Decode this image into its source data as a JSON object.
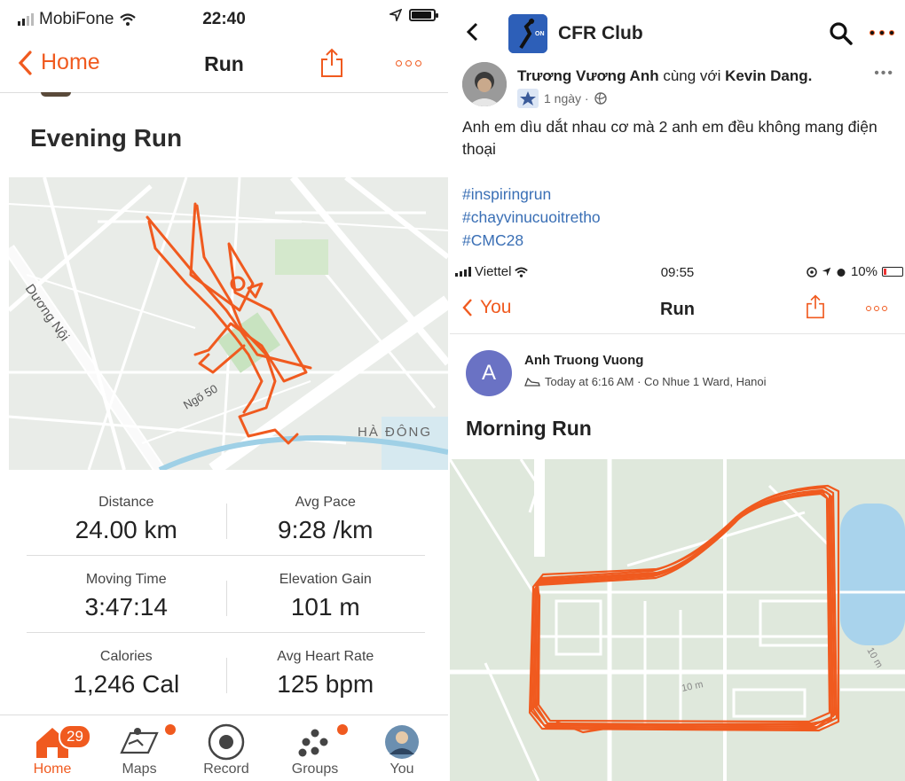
{
  "left": {
    "status": {
      "carrier": "MobiFone",
      "time": "22:40"
    },
    "nav": {
      "back_label": "Home",
      "title": "Run"
    },
    "activity_title": "Evening Run",
    "map_labels": {
      "road1": "Dương Nội",
      "road2": "Ngõ 50",
      "district": "HÀ ĐÔNG"
    },
    "stats": [
      {
        "label": "Distance",
        "value": "24.00 km"
      },
      {
        "label": "Avg Pace",
        "value": "9:28 /km"
      },
      {
        "label": "Moving Time",
        "value": "3:47:14"
      },
      {
        "label": "Elevation Gain",
        "value": "101 m"
      },
      {
        "label": "Calories",
        "value": "1,246 Cal"
      },
      {
        "label": "Avg Heart Rate",
        "value": "125 bpm"
      }
    ],
    "tabs": [
      {
        "label": "Home",
        "icon": "home-icon",
        "badge": "29"
      },
      {
        "label": "Maps",
        "icon": "map-icon"
      },
      {
        "label": "Record",
        "icon": "record-icon"
      },
      {
        "label": "Groups",
        "icon": "groups-icon"
      },
      {
        "label": "You",
        "icon": "avatar-icon"
      }
    ]
  },
  "right": {
    "header": {
      "group_name": "CFR Club"
    },
    "post": {
      "author": "Trương Vương Anh",
      "with_text": "cùng với",
      "tagged": "Kevin Dang.",
      "time": "1 ngày ·",
      "text": "Anh em dìu dắt nhau cơ mà 2 anh em đều không mang điện thoại",
      "hashtags": [
        "#inspiringrun",
        "#chayvinucuoitretho",
        "#CMC28"
      ]
    },
    "status": {
      "carrier": "Viettel",
      "time": "09:55",
      "battery": "10%"
    },
    "nav": {
      "back_label": "You",
      "title": "Run"
    },
    "athlete": {
      "initial": "A",
      "name": "Anh Truong Vuong",
      "meta": "Today at 6:16 AM · Co Nhue 1 Ward, Hanoi"
    },
    "activity_title": "Morning Run",
    "map_labels": {
      "contour1": "10 m",
      "contour2": "10 m"
    }
  },
  "colors": {
    "accent": "#f05a1f",
    "link": "#3a6fb5",
    "route": "#f05a1f"
  }
}
